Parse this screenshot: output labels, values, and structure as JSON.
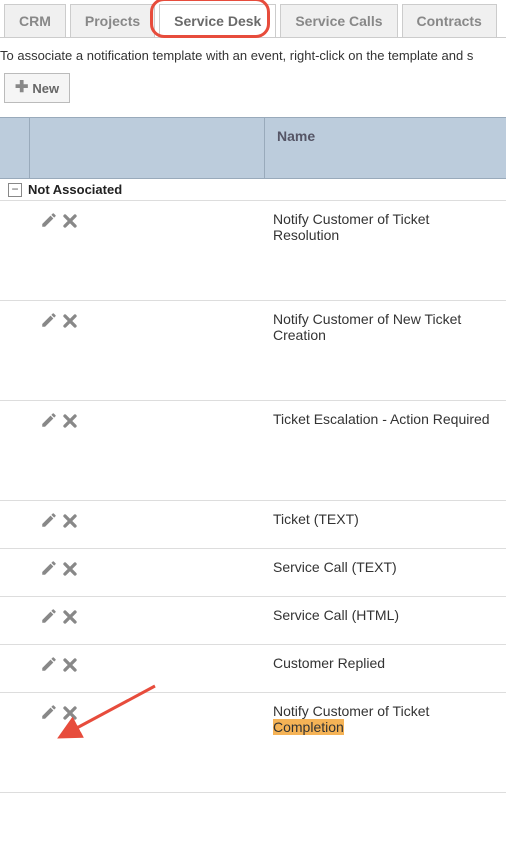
{
  "tabs": [
    {
      "label": "CRM"
    },
    {
      "label": "Projects"
    },
    {
      "label": "Service Desk",
      "active": true
    },
    {
      "label": "Service Calls"
    },
    {
      "label": "Contracts"
    }
  ],
  "instruction": "To associate a notification template with an event, right-click on the template and s",
  "new_button": "New",
  "column_header": "Name",
  "group": {
    "label": "Not Associated",
    "collapse_symbol": "−"
  },
  "rows": [
    {
      "name": "Notify Customer of Ticket Resolution",
      "tall": true
    },
    {
      "name": "Notify Customer of New Ticket Creation",
      "tall": true
    },
    {
      "name": "Ticket Escalation - Action Required",
      "tall": true
    },
    {
      "name": "Ticket (TEXT)",
      "tall": false
    },
    {
      "name": "Service Call (TEXT)",
      "tall": false
    },
    {
      "name": "Service Call (HTML)",
      "tall": false
    },
    {
      "name": "Customer Replied",
      "tall": false
    },
    {
      "name_pre": "Notify Customer of Ticket ",
      "name_hl": "Completion",
      "tall": true,
      "highlighted": true
    }
  ],
  "annotation": {
    "tab_highlight_target": "Service Desk",
    "arrow_target_row": 7
  }
}
